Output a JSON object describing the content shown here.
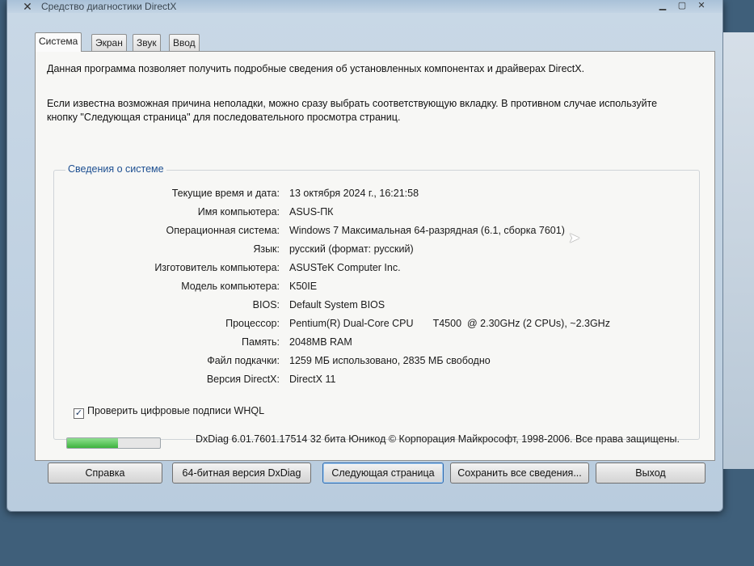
{
  "window": {
    "title": "Средство диагностики DirectX",
    "icon": "directx-x-icon"
  },
  "tabs": [
    {
      "label": "Система",
      "active": true
    },
    {
      "label": "Экран",
      "active": false
    },
    {
      "label": "Звук",
      "active": false
    },
    {
      "label": "Ввод",
      "active": false
    }
  ],
  "intro": {
    "line1": "Данная программа позволяет получить подробные сведения об установленных компонентах и драйверах DirectX.",
    "line2": "Если известна возможная причина неполадки, можно сразу выбрать соответствующую вкладку. В противном случае используйте",
    "line3": "кнопку \"Следующая страница\" для последовательного просмотра страниц."
  },
  "system_info": {
    "title": "Сведения о системе",
    "rows": [
      {
        "label": "Текущие время и дата:",
        "value": "13 октября 2024 г., 16:21:58"
      },
      {
        "label": "Имя компьютера:",
        "value": "ASUS-ПК"
      },
      {
        "label": "Операционная система:",
        "value": "Windows 7 Максимальная 64-разрядная (6.1, сборка 7601)"
      },
      {
        "label": "Язык:",
        "value": "русский (формат: русский)"
      },
      {
        "label": "Изготовитель компьютера:",
        "value": "ASUSTeK Computer Inc."
      },
      {
        "label": "Модель компьютера:",
        "value": "K50IE"
      },
      {
        "label": "BIOS:",
        "value": "Default System BIOS"
      },
      {
        "label": "Процессор:",
        "value": "Pentium(R) Dual-Core CPU       T4500  @ 2.30GHz (2 CPUs), ~2.3GHz"
      },
      {
        "label": "Память:",
        "value": "2048MB RAM"
      },
      {
        "label": "Файл подкачки:",
        "value": "1259 МБ использовано, 2835 МБ свободно"
      },
      {
        "label": "Версия DirectX:",
        "value": "DirectX 11"
      }
    ]
  },
  "whql_checkbox": {
    "label": "Проверить цифровые подписи WHQL",
    "checked": true
  },
  "progress": {
    "fraction": 0.55
  },
  "footer": {
    "info": "DxDiag 6.01.7601.17514 32 бита Юникод  © Корпорация Майкрософт, 1998-2006.  Все права защищены."
  },
  "buttons": {
    "help": "Справка",
    "dxdiag64": "64-битная версия DxDiag",
    "next": "Следующая страница",
    "save": "Сохранить все сведения...",
    "exit": "Выход"
  }
}
